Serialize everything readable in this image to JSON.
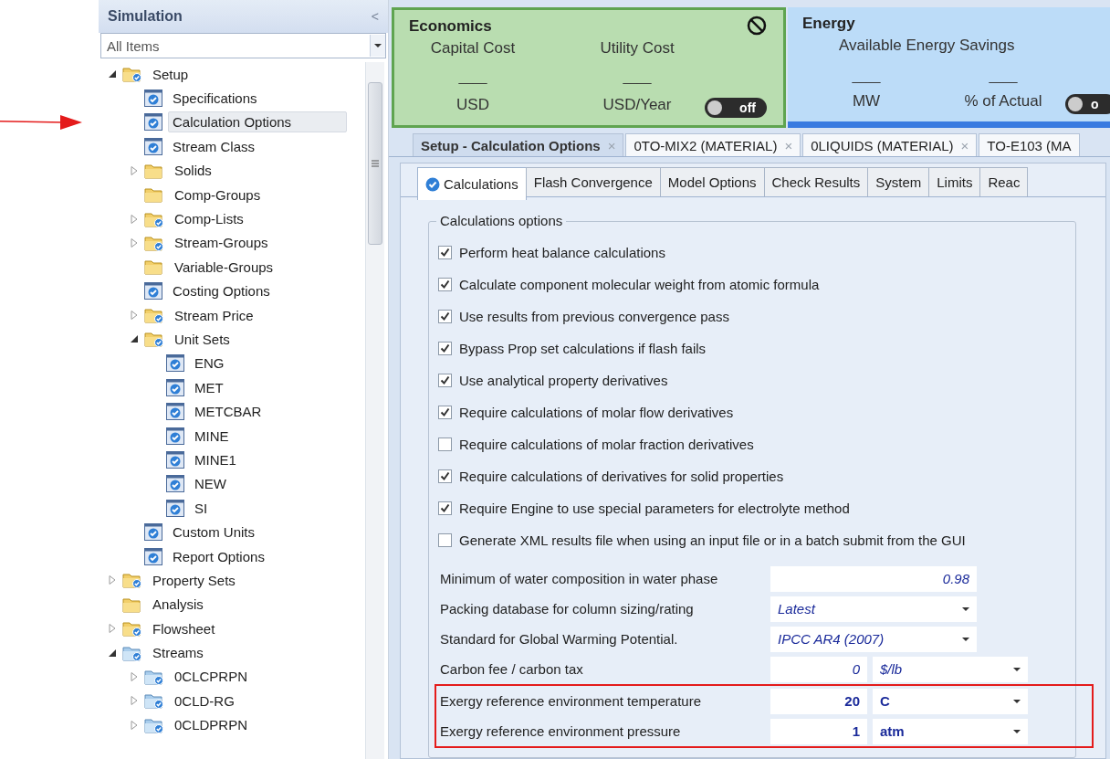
{
  "sidebar": {
    "title": "Simulation",
    "collapse_glyph": "<",
    "filter": {
      "value": "All Items"
    },
    "tree": [
      {
        "label": "Setup",
        "kind": "folder-check",
        "expanded": true,
        "selected": false,
        "children": [
          {
            "label": "Specifications",
            "kind": "form",
            "selected": false
          },
          {
            "label": "Calculation Options",
            "kind": "form",
            "selected": true,
            "arrow": true
          },
          {
            "label": "Stream Class",
            "kind": "form",
            "selected": false
          },
          {
            "label": "Solids",
            "kind": "folder",
            "expanded": false,
            "selected": false
          },
          {
            "label": "Comp-Groups",
            "kind": "folder",
            "selected": false
          },
          {
            "label": "Comp-Lists",
            "kind": "folder-check",
            "expanded": false,
            "selected": false
          },
          {
            "label": "Stream-Groups",
            "kind": "folder-check",
            "expanded": false,
            "selected": false
          },
          {
            "label": "Variable-Groups",
            "kind": "folder",
            "selected": false
          },
          {
            "label": "Costing Options",
            "kind": "form",
            "selected": false
          },
          {
            "label": "Stream Price",
            "kind": "folder-check",
            "expanded": false,
            "selected": false
          },
          {
            "label": "Unit Sets",
            "kind": "folder-check",
            "expanded": true,
            "selected": false,
            "children": [
              {
                "label": "ENG",
                "kind": "form",
                "selected": false
              },
              {
                "label": "MET",
                "kind": "form",
                "selected": false
              },
              {
                "label": "METCBAR",
                "kind": "form",
                "selected": false
              },
              {
                "label": "MINE",
                "kind": "form",
                "selected": false
              },
              {
                "label": "MINE1",
                "kind": "form",
                "selected": false
              },
              {
                "label": "NEW",
                "kind": "form",
                "selected": false
              },
              {
                "label": "SI",
                "kind": "form",
                "selected": false
              }
            ]
          },
          {
            "label": "Custom Units",
            "kind": "form",
            "selected": false
          },
          {
            "label": "Report Options",
            "kind": "form",
            "selected": false
          }
        ]
      },
      {
        "label": "Property Sets",
        "kind": "folder-check",
        "expanded": false,
        "selected": false
      },
      {
        "label": "Analysis",
        "kind": "folder",
        "selected": false
      },
      {
        "label": "Flowsheet",
        "kind": "folder-check",
        "expanded": false,
        "selected": false
      },
      {
        "label": "Streams",
        "kind": "stream-folder",
        "expanded": true,
        "selected": false,
        "children": [
          {
            "label": "0CLCPRPN",
            "kind": "stream-folder",
            "expanded": false,
            "selected": false
          },
          {
            "label": "0CLD-RG",
            "kind": "stream-folder",
            "expanded": false,
            "selected": false
          },
          {
            "label": "0CLDPRPN",
            "kind": "stream-folder",
            "expanded": false,
            "selected": false
          }
        ]
      }
    ]
  },
  "dashboards": [
    {
      "kind": "economics",
      "title": "Economics",
      "disabled_icon": true,
      "metrics": [
        {
          "label": "Capital Cost",
          "value": "____",
          "unit": "USD"
        },
        {
          "label": "Utility Cost",
          "value": "____",
          "unit": "USD/Year"
        }
      ],
      "toggle": {
        "label": "off",
        "on": false
      }
    },
    {
      "kind": "energy",
      "title": "Energy",
      "heading": "Available Energy Savings",
      "metrics": [
        {
          "value": "____",
          "unit": "MW"
        },
        {
          "value": "____",
          "unit": "% of Actual"
        }
      ],
      "toggle": {
        "label": "o",
        "on": false
      }
    }
  ],
  "document_tabs": [
    {
      "label": "Setup - Calculation Options",
      "close": "×",
      "selected": true
    },
    {
      "label": "0TO-MIX2 (MATERIAL)",
      "close": "×",
      "selected": false
    },
    {
      "label": "0LIQUIDS (MATERIAL)",
      "close": "×",
      "selected": false
    },
    {
      "label": "TO-E103 (MA",
      "selected": false
    }
  ],
  "form_tabs": [
    {
      "label": "Calculations",
      "status_icon": true,
      "selected": true
    },
    {
      "label": "Flash Convergence",
      "selected": false
    },
    {
      "label": "Model Options",
      "selected": false
    },
    {
      "label": "Check Results",
      "selected": false
    },
    {
      "label": "System",
      "selected": false
    },
    {
      "label": "Limits",
      "selected": false
    },
    {
      "label": "Reac",
      "selected": false
    }
  ],
  "calculations_options": {
    "title": "Calculations options",
    "options": [
      {
        "label": "Perform heat balance calculations",
        "checked": true
      },
      {
        "label": "Calculate component molecular weight from atomic formula",
        "checked": true
      },
      {
        "label": "Use results from previous convergence pass",
        "checked": true
      },
      {
        "label": "Bypass Prop set calculations if flash fails",
        "checked": true
      },
      {
        "label": "Use analytical property derivatives",
        "checked": true
      },
      {
        "label": "Require calculations of molar flow derivatives",
        "checked": true
      },
      {
        "label": "Require calculations of molar fraction derivatives",
        "checked": false
      },
      {
        "label": "Require calculations of derivatives for solid properties",
        "checked": true
      },
      {
        "label": "Require Engine to use special parameters for electrolyte method",
        "checked": true
      },
      {
        "label": "Generate XML results file when using an input file or in a batch submit from the GUI",
        "checked": false
      }
    ],
    "fields": [
      {
        "label": "Minimum of water composition in water phase",
        "kind": "number",
        "value": "0.98",
        "user_entered": false,
        "highlighted": false
      },
      {
        "label": "Packing database for column sizing/rating",
        "kind": "select",
        "value": "Latest",
        "user_entered": false,
        "highlighted": false
      },
      {
        "label": "Standard for Global Warming Potential.",
        "kind": "select",
        "value": "IPCC AR4 (2007)",
        "user_entered": false,
        "highlighted": false
      },
      {
        "label": "Carbon fee / carbon tax",
        "kind": "number-unit",
        "value": "0",
        "unit": "$/lb",
        "user_entered": false,
        "highlighted": false
      },
      {
        "label": "Exergy reference environment temperature",
        "kind": "number-unit",
        "value": "20",
        "unit": "C",
        "user_entered": true,
        "highlighted": true
      },
      {
        "label": "Exergy reference environment pressure",
        "kind": "number-unit",
        "value": "1",
        "unit": "atm",
        "user_entered": true,
        "highlighted": true
      }
    ]
  }
}
